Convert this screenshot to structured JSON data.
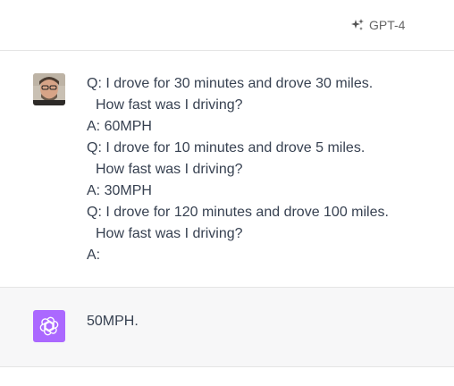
{
  "header": {
    "model_label": "GPT-4",
    "model_icon": "sparkle-icon"
  },
  "user_message": {
    "avatar": "user-avatar-photo",
    "lines": [
      {
        "text": "Q: I drove for 30 minutes and drove 30 miles.",
        "indent": false
      },
      {
        "text": "How fast was I driving?",
        "indent": true
      },
      {
        "text": "A: 60MPH",
        "indent": false
      },
      {
        "text": "Q: I drove for 10 minutes and drove 5 miles.",
        "indent": false
      },
      {
        "text": "How fast was I driving?",
        "indent": true
      },
      {
        "text": "A: 30MPH",
        "indent": false
      },
      {
        "text": "Q: I drove for 120 minutes and drove 100 miles.",
        "indent": false
      },
      {
        "text": "How fast was I driving?",
        "indent": true
      },
      {
        "text": "A:",
        "indent": false
      }
    ]
  },
  "assistant_message": {
    "avatar": "openai-logo-icon",
    "avatar_color": "#ab68ff",
    "text": "50MPH."
  }
}
